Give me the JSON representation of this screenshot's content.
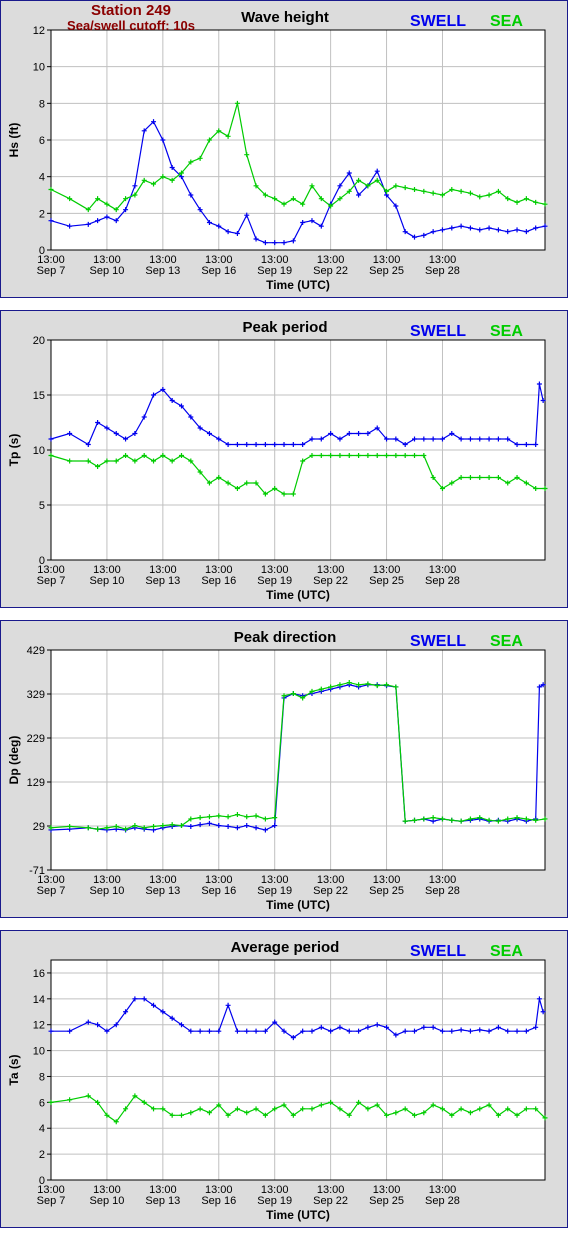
{
  "header": {
    "station": "Station 249",
    "cutoff": "Sea/swell cutoff: 10s"
  },
  "colors": {
    "swell": "#0000ee",
    "sea": "#00cc00",
    "grid": "#c0c0c0",
    "frame": "#1a1a8c"
  },
  "chart_data": [
    {
      "type": "line",
      "title": "Wave height",
      "xlabel": "Time (UTC)",
      "ylabel": "Hs (ft)",
      "ylim": [
        0,
        12
      ],
      "yticks": [
        "0",
        "2",
        "4",
        "6",
        "8",
        "10",
        "12"
      ],
      "xlim": [
        0,
        26.5
      ],
      "xticks": [
        {
          "time": "13:00",
          "date": "Sep 7"
        },
        {
          "time": "13:00",
          "date": "Sep 10"
        },
        {
          "time": "13:00",
          "date": "Sep 13"
        },
        {
          "time": "13:00",
          "date": "Sep 16"
        },
        {
          "time": "13:00",
          "date": "Sep 19"
        },
        {
          "time": "13:00",
          "date": "Sep 22"
        },
        {
          "time": "13:00",
          "date": "Sep 25"
        },
        {
          "time": "13:00",
          "date": "Sep 28"
        }
      ],
      "grid": true,
      "legend": "top-right",
      "series": [
        {
          "name": "SWELL",
          "x": [
            0,
            1,
            2,
            2.5,
            3,
            3.5,
            4,
            4.5,
            5,
            5.5,
            6,
            6.5,
            7,
            7.5,
            8,
            8.5,
            9,
            9.5,
            10,
            10.5,
            11,
            11.5,
            12,
            12.5,
            13,
            13.5,
            14,
            14.5,
            15,
            15.5,
            16,
            16.5,
            17,
            17.5,
            18,
            18.5,
            19,
            19.5,
            20,
            20.5,
            21,
            21.5,
            22,
            22.5,
            23,
            23.5,
            24,
            24.5,
            25,
            25.5,
            26,
            26.5
          ],
          "values": [
            1.6,
            1.3,
            1.4,
            1.6,
            1.8,
            1.6,
            2.2,
            3.5,
            6.5,
            7,
            6,
            4.5,
            4,
            3,
            2.2,
            1.5,
            1.3,
            1,
            0.9,
            1.9,
            0.6,
            0.4,
            0.4,
            0.4,
            0.5,
            1.5,
            1.6,
            1.3,
            2.5,
            3.5,
            4.2,
            3,
            3.5,
            4.3,
            3,
            2.4,
            1,
            0.7,
            0.8,
            1,
            1.1,
            1.2,
            1.3,
            1.2,
            1.1,
            1.2,
            1.1,
            1,
            1.1,
            1.0,
            1.2,
            1.3
          ]
        },
        {
          "name": "SEA",
          "x": [
            0,
            1,
            2,
            2.5,
            3,
            3.5,
            4,
            4.5,
            5,
            5.5,
            6,
            6.5,
            7,
            7.5,
            8,
            8.5,
            9,
            9.5,
            10,
            10.5,
            11,
            11.5,
            12,
            12.5,
            13,
            13.5,
            14,
            14.5,
            15,
            15.5,
            16,
            16.5,
            17,
            17.5,
            18,
            18.5,
            19,
            19.5,
            20,
            20.5,
            21,
            21.5,
            22,
            22.5,
            23,
            23.5,
            24,
            24.5,
            25,
            25.5,
            26,
            26.5
          ],
          "values": [
            3.3,
            2.8,
            2.2,
            2.8,
            2.5,
            2.2,
            2.8,
            3,
            3.8,
            3.6,
            4,
            3.8,
            4.2,
            4.8,
            5,
            6,
            6.5,
            6.2,
            8,
            5.2,
            3.5,
            3,
            2.8,
            2.5,
            2.8,
            2.5,
            3.5,
            2.8,
            2.4,
            2.8,
            3.2,
            3.8,
            3.5,
            3.8,
            3.2,
            3.5,
            3.4,
            3.3,
            3.2,
            3.1,
            3.0,
            3.3,
            3.2,
            3.1,
            2.9,
            3.0,
            3.2,
            2.8,
            2.6,
            2.8,
            2.6,
            2.5
          ]
        }
      ]
    },
    {
      "type": "line",
      "title": "Peak period",
      "xlabel": "Time (UTC)",
      "ylabel": "Tp (s)",
      "ylim": [
        0,
        20
      ],
      "yticks": [
        "0",
        "5",
        "10",
        "15",
        "20"
      ],
      "xlim": [
        0,
        26.5
      ],
      "xticks": [
        {
          "time": "13:00",
          "date": "Sep 7"
        },
        {
          "time": "13:00",
          "date": "Sep 10"
        },
        {
          "time": "13:00",
          "date": "Sep 13"
        },
        {
          "time": "13:00",
          "date": "Sep 16"
        },
        {
          "time": "13:00",
          "date": "Sep 19"
        },
        {
          "time": "13:00",
          "date": "Sep 22"
        },
        {
          "time": "13:00",
          "date": "Sep 25"
        },
        {
          "time": "13:00",
          "date": "Sep 28"
        }
      ],
      "grid": true,
      "legend": "top-right",
      "series": [
        {
          "name": "SWELL",
          "x": [
            0,
            1,
            2,
            2.5,
            3,
            3.5,
            4,
            4.5,
            5,
            5.5,
            6,
            6.5,
            7,
            7.5,
            8,
            8.5,
            9,
            9.5,
            10,
            10.5,
            11,
            11.5,
            12,
            12.5,
            13,
            13.5,
            14,
            14.5,
            15,
            15.5,
            16,
            16.5,
            17,
            17.5,
            18,
            18.5,
            19,
            19.5,
            20,
            20.5,
            21,
            21.5,
            22,
            22.5,
            23,
            23.5,
            24,
            24.5,
            25,
            25.5,
            26,
            26.2,
            26.4
          ],
          "values": [
            11,
            11.5,
            10.5,
            12.5,
            12,
            11.5,
            11,
            11.5,
            13,
            15,
            15.5,
            14.5,
            14,
            13,
            12,
            11.5,
            11,
            10.5,
            10.5,
            10.5,
            10.5,
            10.5,
            10.5,
            10.5,
            10.5,
            10.5,
            11,
            11,
            11.5,
            11,
            11.5,
            11.5,
            11.5,
            12,
            11,
            11,
            10.5,
            11,
            11,
            11,
            11,
            11.5,
            11,
            11,
            11,
            11,
            11,
            11,
            10.5,
            10.5,
            10.5,
            16,
            14.5
          ]
        },
        {
          "name": "SEA",
          "x": [
            0,
            1,
            2,
            2.5,
            3,
            3.5,
            4,
            4.5,
            5,
            5.5,
            6,
            6.5,
            7,
            7.5,
            8,
            8.5,
            9,
            9.5,
            10,
            10.5,
            11,
            11.5,
            12,
            12.5,
            13,
            13.5,
            14,
            14.5,
            15,
            15.5,
            16,
            16.5,
            17,
            17.5,
            18,
            18.5,
            19,
            19.5,
            20,
            20.5,
            21,
            21.5,
            22,
            22.5,
            23,
            23.5,
            24,
            24.5,
            25,
            25.5,
            26,
            26.5
          ],
          "values": [
            9.5,
            9,
            9,
            8.5,
            9,
            9,
            9.5,
            9,
            9.5,
            9,
            9.5,
            9,
            9.5,
            9,
            8,
            7,
            7.5,
            7,
            6.5,
            7,
            7,
            6,
            6.5,
            6,
            6,
            9,
            9.5,
            9.5,
            9.5,
            9.5,
            9.5,
            9.5,
            9.5,
            9.5,
            9.5,
            9.5,
            9.5,
            9.5,
            9.5,
            7.5,
            6.5,
            7,
            7.5,
            7.5,
            7.5,
            7.5,
            7.5,
            7,
            7.5,
            7,
            6.5,
            6.5
          ]
        }
      ]
    },
    {
      "type": "line",
      "title": "Peak direction",
      "xlabel": "Time (UTC)",
      "ylabel": "Dp (deg)",
      "ylim": [
        -71,
        429
      ],
      "yticks": [
        "-71",
        "29",
        "129",
        "229",
        "329",
        "429"
      ],
      "xlim": [
        0,
        26.5
      ],
      "xticks": [
        {
          "time": "13:00",
          "date": "Sep 7"
        },
        {
          "time": "13:00",
          "date": "Sep 10"
        },
        {
          "time": "13:00",
          "date": "Sep 13"
        },
        {
          "time": "13:00",
          "date": "Sep 16"
        },
        {
          "time": "13:00",
          "date": "Sep 19"
        },
        {
          "time": "13:00",
          "date": "Sep 22"
        },
        {
          "time": "13:00",
          "date": "Sep 25"
        },
        {
          "time": "13:00",
          "date": "Sep 28"
        }
      ],
      "grid": true,
      "legend": "top-right",
      "series": [
        {
          "name": "SWELL",
          "x": [
            0,
            1,
            2,
            2.5,
            3,
            3.5,
            4,
            4.5,
            5,
            5.5,
            6,
            6.5,
            7,
            7.5,
            8,
            8.5,
            9,
            9.5,
            10,
            10.5,
            11,
            11.5,
            12,
            12.5,
            13,
            13.5,
            14,
            14.5,
            15,
            15.5,
            16,
            16.5,
            17,
            17.5,
            18,
            18.5,
            19,
            19.5,
            20,
            20.5,
            21,
            21.5,
            22,
            22.5,
            23,
            23.5,
            24,
            24.5,
            25,
            25.5,
            26,
            26.2,
            26.4
          ],
          "values": [
            20,
            22,
            25,
            22,
            20,
            22,
            20,
            25,
            22,
            20,
            25,
            28,
            30,
            28,
            32,
            35,
            30,
            28,
            25,
            30,
            25,
            20,
            30,
            320,
            330,
            325,
            330,
            335,
            340,
            345,
            350,
            345,
            350,
            350,
            348,
            345,
            40,
            42,
            45,
            40,
            45,
            42,
            40,
            42,
            45,
            40,
            42,
            40,
            45,
            40,
            45,
            345,
            350
          ]
        },
        {
          "name": "SEA",
          "x": [
            0,
            1,
            2,
            2.5,
            3,
            3.5,
            4,
            4.5,
            5,
            5.5,
            6,
            6.5,
            7,
            7.5,
            8,
            8.5,
            9,
            9.5,
            10,
            10.5,
            11,
            11.5,
            12,
            12.5,
            13,
            13.5,
            14,
            14.5,
            15,
            15.5,
            16,
            16.5,
            17,
            17.5,
            18,
            18.5,
            19,
            19.5,
            20,
            20.5,
            21,
            21.5,
            22,
            22.5,
            23,
            23.5,
            24,
            24.5,
            25,
            25.5,
            26,
            26.5
          ],
          "values": [
            25,
            28,
            25,
            22,
            25,
            28,
            22,
            30,
            25,
            28,
            30,
            32,
            30,
            45,
            48,
            50,
            52,
            50,
            55,
            50,
            52,
            45,
            48,
            325,
            330,
            320,
            335,
            340,
            345,
            350,
            355,
            350,
            352,
            348,
            350,
            345,
            40,
            42,
            45,
            48,
            45,
            42,
            40,
            45,
            48,
            42,
            40,
            45,
            48,
            45,
            42,
            45
          ]
        }
      ]
    },
    {
      "type": "line",
      "title": "Average period",
      "xlabel": "Time (UTC)",
      "ylabel": "Ta (s)",
      "ylim": [
        0,
        17
      ],
      "yticks": [
        "0",
        "2",
        "4",
        "6",
        "8",
        "10",
        "12",
        "14",
        "16"
      ],
      "xlim": [
        0,
        26.5
      ],
      "xticks": [
        {
          "time": "13:00",
          "date": "Sep 7"
        },
        {
          "time": "13:00",
          "date": "Sep 10"
        },
        {
          "time": "13:00",
          "date": "Sep 13"
        },
        {
          "time": "13:00",
          "date": "Sep 16"
        },
        {
          "time": "13:00",
          "date": "Sep 19"
        },
        {
          "time": "13:00",
          "date": "Sep 22"
        },
        {
          "time": "13:00",
          "date": "Sep 25"
        },
        {
          "time": "13:00",
          "date": "Sep 28"
        }
      ],
      "grid": true,
      "legend": "top-right",
      "series": [
        {
          "name": "SWELL",
          "x": [
            0,
            1,
            2,
            2.5,
            3,
            3.5,
            4,
            4.5,
            5,
            5.5,
            6,
            6.5,
            7,
            7.5,
            8,
            8.5,
            9,
            9.5,
            10,
            10.5,
            11,
            11.5,
            12,
            12.5,
            13,
            13.5,
            14,
            14.5,
            15,
            15.5,
            16,
            16.5,
            17,
            17.5,
            18,
            18.5,
            19,
            19.5,
            20,
            20.5,
            21,
            21.5,
            22,
            22.5,
            23,
            23.5,
            24,
            24.5,
            25,
            25.5,
            26,
            26.2,
            26.4
          ],
          "values": [
            11.5,
            11.5,
            12.2,
            12,
            11.5,
            12,
            13,
            14,
            14,
            13.5,
            13,
            12.5,
            12,
            11.5,
            11.5,
            11.5,
            11.5,
            13.5,
            11.5,
            11.5,
            11.5,
            11.5,
            12.2,
            11.5,
            11,
            11.5,
            11.5,
            11.8,
            11.5,
            11.8,
            11.5,
            11.5,
            11.8,
            12,
            11.8,
            11.2,
            11.5,
            11.5,
            11.8,
            11.8,
            11.5,
            11.5,
            11.6,
            11.5,
            11.6,
            11.5,
            11.8,
            11.5,
            11.5,
            11.5,
            11.8,
            14,
            13
          ]
        },
        {
          "name": "SEA",
          "x": [
            0,
            1,
            2,
            2.5,
            3,
            3.5,
            4,
            4.5,
            5,
            5.5,
            6,
            6.5,
            7,
            7.5,
            8,
            8.5,
            9,
            9.5,
            10,
            10.5,
            11,
            11.5,
            12,
            12.5,
            13,
            13.5,
            14,
            14.5,
            15,
            15.5,
            16,
            16.5,
            17,
            17.5,
            18,
            18.5,
            19,
            19.5,
            20,
            20.5,
            21,
            21.5,
            22,
            22.5,
            23,
            23.5,
            24,
            24.5,
            25,
            25.5,
            26,
            26.5
          ],
          "values": [
            6,
            6.2,
            6.5,
            6,
            5,
            4.5,
            5.5,
            6.5,
            6,
            5.5,
            5.5,
            5,
            5,
            5.2,
            5.5,
            5.2,
            5.8,
            5,
            5.5,
            5.2,
            5.5,
            5,
            5.5,
            5.8,
            5,
            5.5,
            5.5,
            5.8,
            6,
            5.5,
            5,
            6,
            5.5,
            5.8,
            5,
            5.2,
            5.5,
            5,
            5.2,
            5.8,
            5.5,
            5,
            5.5,
            5.2,
            5.5,
            5.8,
            5,
            5.5,
            5,
            5.5,
            5.5,
            4.8
          ]
        }
      ]
    }
  ]
}
